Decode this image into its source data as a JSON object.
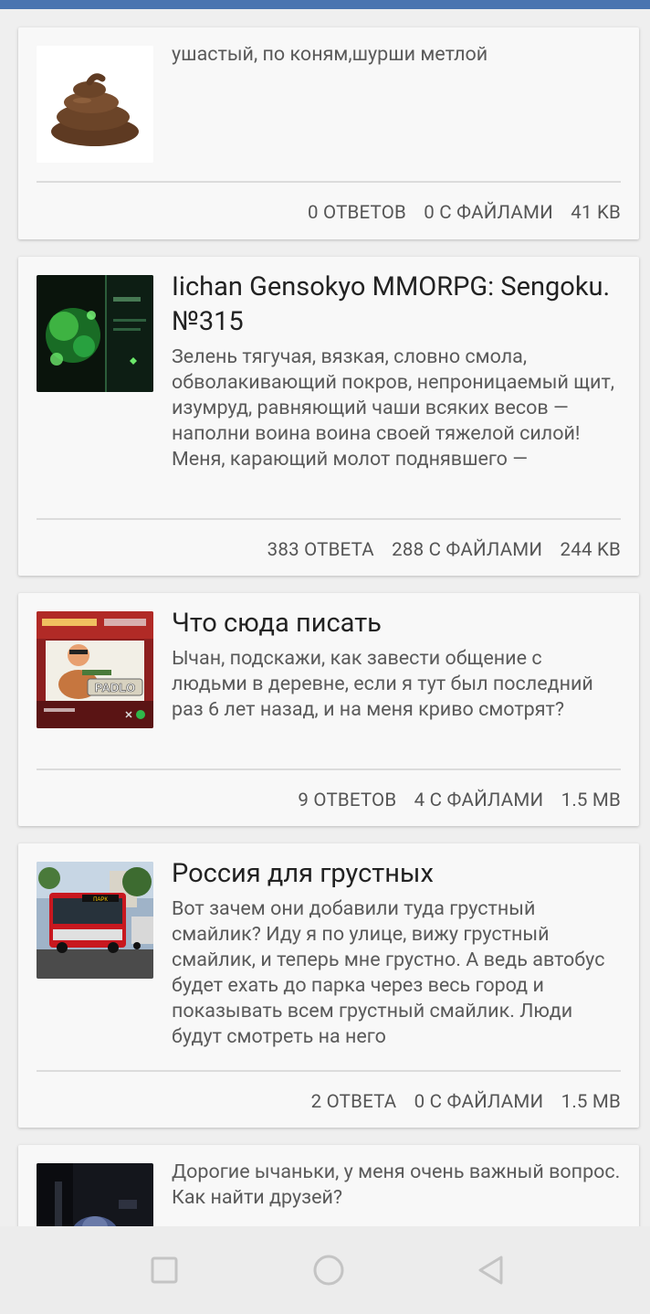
{
  "threads": [
    {
      "title": "",
      "excerpt": "ушастый, по коням,шурши метлой",
      "replies": "0 ответов",
      "files": "0 с файлами",
      "size": "41 KB"
    },
    {
      "title": "Iichan Gensokyo MMORPG: Sengoku. №315",
      "excerpt": "Зелень тягучая, вязкая, словно смола, обволакивающий покров, непроницаемый щит, изумруд, равняющий чаши всяких весов — наполни воина воина своей тяжелой силой!\nМеня, карающий молот поднявшего —",
      "replies": "383 ответа",
      "files": "288 с файлами",
      "size": "244 KB"
    },
    {
      "title": "Что сюда писать",
      "excerpt": "Ычан, подскажи, как завести общение с людьми в деревне, если я тут был последний раз 6 лет назад, и на меня криво смотрят?",
      "replies": "9 ответов",
      "files": "4 с файлами",
      "size": "1.5 MB"
    },
    {
      "title": "Россия для грустных",
      "excerpt": "Вот зачем они добавили туда грустный смайлик? Иду я по улице, вижу грустный смайлик, и теперь мне грустно. А ведь автобус будет ехать до парка через весь город и показывать всем грустный смайлик. Люди будут смотреть на него",
      "replies": "2 ответа",
      "files": "0 с файлами",
      "size": "1.5 MB"
    },
    {
      "title": "",
      "excerpt": "Дорогие ычаньки, у меня очень важный вопрос.\nКак найти друзей?"
    }
  ],
  "thumb_text": {
    "padlo": "PADLO",
    "bus_route": "ПАРК"
  },
  "nav": {
    "icons": [
      "recents-square-icon",
      "home-circle-icon",
      "back-triangle-icon"
    ]
  },
  "colors": {
    "statusbar": "#4a74b0",
    "card": "#f8f8f8",
    "background": "#efefef"
  }
}
